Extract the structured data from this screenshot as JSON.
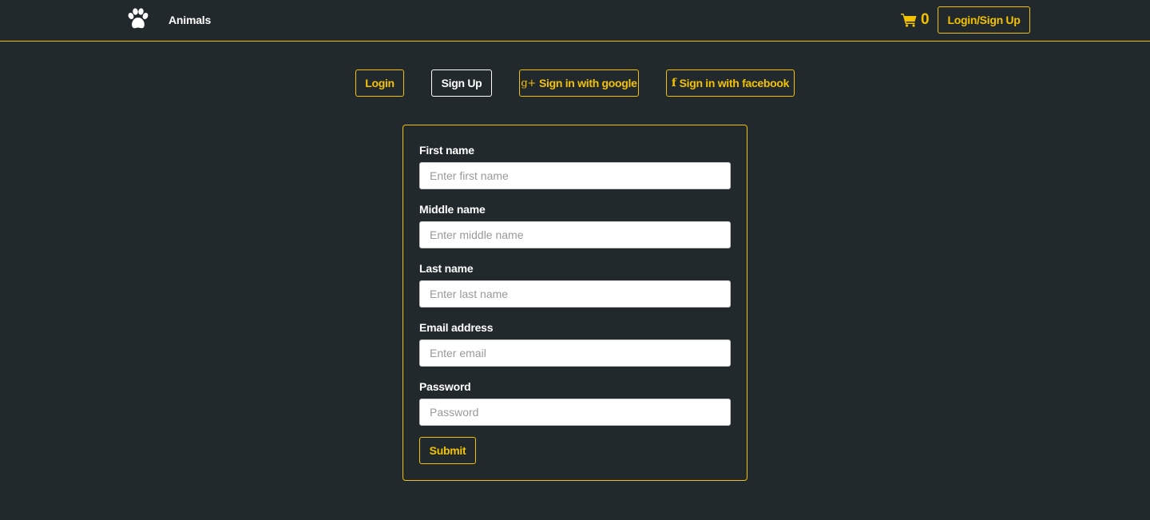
{
  "navbar": {
    "brand_icon": "paw-icon",
    "brand_name": "Animals",
    "cart_icon": "shopping-cart-icon",
    "cart_count": "0",
    "login_signup_label": "Login/Sign Up"
  },
  "tabs": {
    "login_label": "Login",
    "signup_label": "Sign Up",
    "google_icon_text": "g+",
    "google_label": "Sign in with google",
    "facebook_icon_text": "f",
    "facebook_label": "Sign in with facebook",
    "active": "Sign Up"
  },
  "form": {
    "first_name": {
      "label": "First name",
      "placeholder": "Enter first name",
      "value": ""
    },
    "middle_name": {
      "label": "Middle name",
      "placeholder": "Enter middle name",
      "value": ""
    },
    "last_name": {
      "label": "Last name",
      "placeholder": "Enter last name",
      "value": ""
    },
    "email": {
      "label": "Email address",
      "placeholder": "Enter email",
      "value": ""
    },
    "password": {
      "label": "Password",
      "placeholder": "Password",
      "value": ""
    },
    "submit_label": "Submit"
  },
  "colors": {
    "background": "#22292c",
    "accent": "#f2c200",
    "text": "#ffffff"
  }
}
